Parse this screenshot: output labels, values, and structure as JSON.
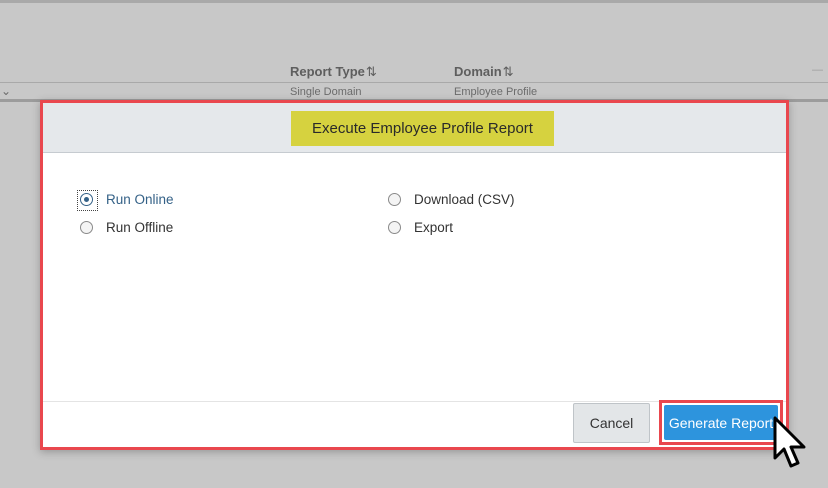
{
  "table": {
    "columns": [
      {
        "label": "Report Type",
        "sort_glyph": "⇅"
      },
      {
        "label": "Domain",
        "sort_glyph": "⇅"
      }
    ],
    "row": {
      "report_type": "Single Domain",
      "domain": "Employee Profile"
    }
  },
  "dialog": {
    "title": "Execute Employee Profile Report",
    "title_highlight_color": "#d6d23f",
    "annotation_border_color": "#e9474e",
    "options": {
      "run_online": {
        "label": "Run Online",
        "selected": true
      },
      "run_offline": {
        "label": "Run Offline",
        "selected": false
      },
      "download_csv": {
        "label": "Download (CSV)",
        "selected": false
      },
      "export": {
        "label": "Export",
        "selected": false
      }
    },
    "buttons": {
      "cancel": "Cancel",
      "generate": "Generate Report"
    },
    "accent_color": "#2d94dd"
  }
}
